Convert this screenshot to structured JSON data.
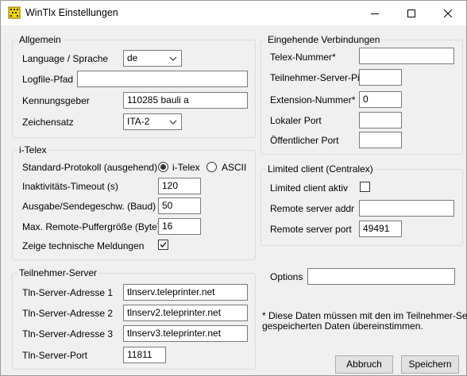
{
  "window": {
    "title": "WinTlx Einstellungen"
  },
  "allgemein": {
    "legend": "Allgemein",
    "language_label": "Language / Sprache",
    "language_value": "de",
    "logfile_label": "Logfile-Pfad",
    "logfile_value": "",
    "kennung_label": "Kennungsgeber",
    "kennung_value": "110285 bauli a",
    "zeichensatz_label": "Zeichensatz",
    "zeichensatz_value": "ITA-2"
  },
  "itelex": {
    "legend": "i-Telex",
    "protokoll_label": "Standard-Protokoll (ausgehend)",
    "radio_itelex": "i-Telex",
    "radio_ascii": "ASCII",
    "timeout_label": "Inaktivitäts-Timeout (s)",
    "timeout_value": "120",
    "baud_label": "Ausgabe/Sendegeschw. (Baud)",
    "baud_value": "50",
    "puffer_label": "Max. Remote-Puffergröße (Byte)",
    "puffer_value": "16",
    "techmeld_label": "Zeige technische Meldungen",
    "techmeld_checked": true
  },
  "tln_server": {
    "legend": "Teilnehmer-Server",
    "addr1_label": "Tln-Server-Adresse 1",
    "addr1_value": "tlnserv.teleprinter.net",
    "addr2_label": "Tln-Server-Adresse 2",
    "addr2_value": "tlnserv2.teleprinter.net",
    "addr3_label": "Tln-Server-Adresse 3",
    "addr3_value": "tlnserv3.teleprinter.net",
    "port_label": "Tln-Server-Port",
    "port_value": "11811"
  },
  "eingehend": {
    "legend": "Eingehende Verbindungen",
    "telex_nr_label": "Telex-Nummer*",
    "telex_nr_value": "",
    "pin_label": "Teilnehmer-Server-Pin*",
    "pin_value": "",
    "extension_label": "Extension-Nummer*",
    "extension_value": "0",
    "lokal_port_label": "Lokaler Port",
    "lokal_port_value": "",
    "oeff_port_label": "Öffentlicher Port",
    "oeff_port_value": ""
  },
  "limited": {
    "legend": "Limited client (Centralex)",
    "aktiv_label": "Limited client aktiv",
    "aktiv_checked": false,
    "addr_label": "Remote server addr",
    "addr_value": "",
    "port_label": "Remote server port",
    "port_value": "49491"
  },
  "options": {
    "label": "Options",
    "value": ""
  },
  "note": {
    "line1": "* Diese Daten müssen mit den im Teilnehmer-Server",
    "line2": "gespeicherten Daten übereinstimmen."
  },
  "buttons": {
    "cancel": "Abbruch",
    "save": "Speichern"
  }
}
